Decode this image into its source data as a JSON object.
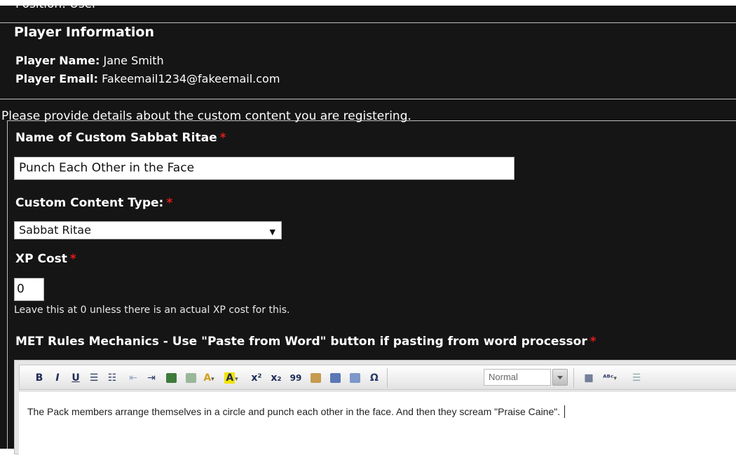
{
  "cut_off_text": "Position: User",
  "player_info": {
    "legend": "Player Information",
    "name_label": "Player Name:",
    "name_value": "Jane Smith",
    "email_label": "Player Email:",
    "email_value": "Fakeemail1234@fakeemail.com"
  },
  "intro_text": "Please provide details about the custom content you are registering.",
  "required_marker": "*",
  "fields": {
    "name": {
      "label": "Name of Custom Sabbat Ritae",
      "value": "Punch Each Other in the Face"
    },
    "type": {
      "label": "Custom Content Type:",
      "value": "Sabbat Ritae"
    },
    "xp": {
      "label": "XP Cost",
      "value": "0",
      "hint": "Leave this at 0 unless there is an actual XP cost for this."
    },
    "mechanics": {
      "label": "MET Rules Mechanics - Use \"Paste from Word\" button if pasting from word processor",
      "content": "The Pack members arrange themselves in a circle and punch each other in the face.  And then they scream \"Praise Caine\"."
    }
  },
  "editor": {
    "format_value": "Normal",
    "buttons": [
      "B",
      "I",
      "U",
      "x²",
      "x₂",
      "99",
      "Ω"
    ]
  },
  "colors": {
    "background": "#151515",
    "required": "#e21b1b",
    "toolbar_icon": "#2b3a67"
  }
}
